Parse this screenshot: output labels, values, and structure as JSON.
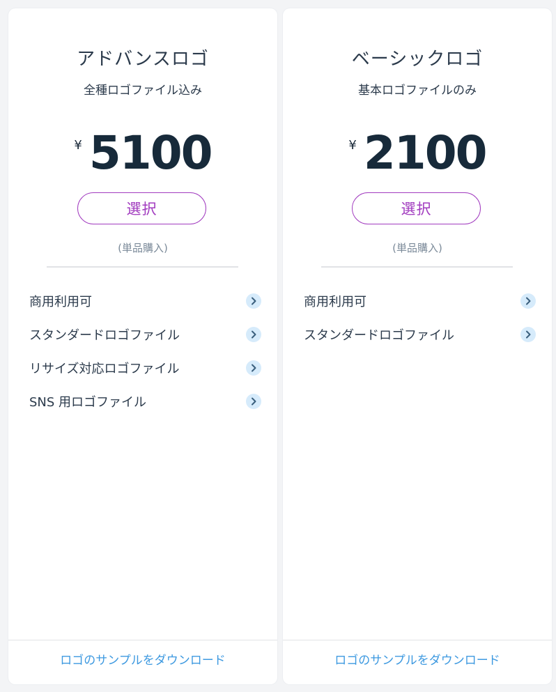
{
  "plans": [
    {
      "title": "アドバンスロゴ",
      "subtitle": "全種ロゴファイル込み",
      "currency": "¥",
      "price": "5100",
      "select_label": "選択",
      "purchase_note": "(単品購入)",
      "features": [
        "商用利用可",
        "スタンダードロゴファイル",
        "リサイズ対応ロゴファイル",
        "SNS 用ロゴファイル"
      ],
      "download_label": "ロゴのサンプルをダウンロード"
    },
    {
      "title": "ベーシックロゴ",
      "subtitle": "基本ロゴファイルのみ",
      "currency": "¥",
      "price": "2100",
      "select_label": "選択",
      "purchase_note": "(単品購入)",
      "features": [
        "商用利用可",
        "スタンダードロゴファイル"
      ],
      "download_label": "ロゴのサンプルをダウンロード"
    }
  ],
  "icons": {
    "feature_chevron": "chevron-right-icon"
  },
  "colors": {
    "accent_button": "#a13bbf",
    "link": "#3d99e0",
    "chevron_bg": "#d6ebfb",
    "chevron_fg": "#3a5f7d",
    "text_dark": "#172a3a",
    "background": "#f3f4f6"
  }
}
